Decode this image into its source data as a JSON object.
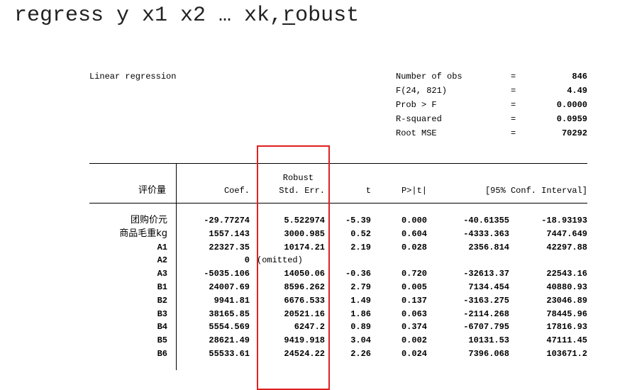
{
  "command": {
    "prefix": "regress y x1 x2 … xk,",
    "underlined": "r",
    "suffix": "obust"
  },
  "output": {
    "title": "Linear regression",
    "stats": [
      {
        "label": "Number of obs",
        "eq": "=",
        "value": "846"
      },
      {
        "label": "F(24, 821)",
        "eq": "=",
        "value": "4.49"
      },
      {
        "label": "Prob > F",
        "eq": "=",
        "value": "0.0000"
      },
      {
        "label": "R-squared",
        "eq": "=",
        "value": "0.0959"
      },
      {
        "label": "Root MSE",
        "eq": "=",
        "value": "70292"
      }
    ],
    "header": {
      "depvar": "评价量",
      "coef": "Coef.",
      "robust": "Robust",
      "stderr": "Std. Err.",
      "t": "t",
      "p": "P>|t|",
      "ci": "[95% Conf. Interval]"
    },
    "rows": [
      {
        "name": "团购价元",
        "coef": "-29.77274",
        "se": "5.522974",
        "t": "-5.39",
        "p": "0.000",
        "lo": "-40.61355",
        "hi": "-18.93193"
      },
      {
        "name": "商品毛重kg",
        "coef": "1557.143",
        "se": "3000.985",
        "t": "0.52",
        "p": "0.604",
        "lo": "-4333.363",
        "hi": "7447.649"
      },
      {
        "name": "A1",
        "coef": "22327.35",
        "se": "10174.21",
        "t": "2.19",
        "p": "0.028",
        "lo": "2356.814",
        "hi": "42297.88"
      },
      {
        "name": "A2",
        "coef": "0",
        "se": "(omitted)",
        "t": "",
        "p": "",
        "lo": "",
        "hi": ""
      },
      {
        "name": "A3",
        "coef": "-5035.106",
        "se": "14050.06",
        "t": "-0.36",
        "p": "0.720",
        "lo": "-32613.37",
        "hi": "22543.16"
      },
      {
        "name": "B1",
        "coef": "24007.69",
        "se": "8596.262",
        "t": "2.79",
        "p": "0.005",
        "lo": "7134.454",
        "hi": "40880.93"
      },
      {
        "name": "B2",
        "coef": "9941.81",
        "se": "6676.533",
        "t": "1.49",
        "p": "0.137",
        "lo": "-3163.275",
        "hi": "23046.89"
      },
      {
        "name": "B3",
        "coef": "38165.85",
        "se": "20521.16",
        "t": "1.86",
        "p": "0.063",
        "lo": "-2114.268",
        "hi": "78445.96"
      },
      {
        "name": "B4",
        "coef": "5554.569",
        "se": "6247.2",
        "t": "0.89",
        "p": "0.374",
        "lo": "-6707.795",
        "hi": "17816.93"
      },
      {
        "name": "B5",
        "coef": "28621.49",
        "se": "9419.918",
        "t": "3.04",
        "p": "0.002",
        "lo": "10131.53",
        "hi": "47111.45"
      },
      {
        "name": "B6",
        "coef": "55533.61",
        "se": "24524.22",
        "t": "2.26",
        "p": "0.024",
        "lo": "7396.068",
        "hi": "103671.2"
      }
    ],
    "highlight_color": "#e02020"
  }
}
